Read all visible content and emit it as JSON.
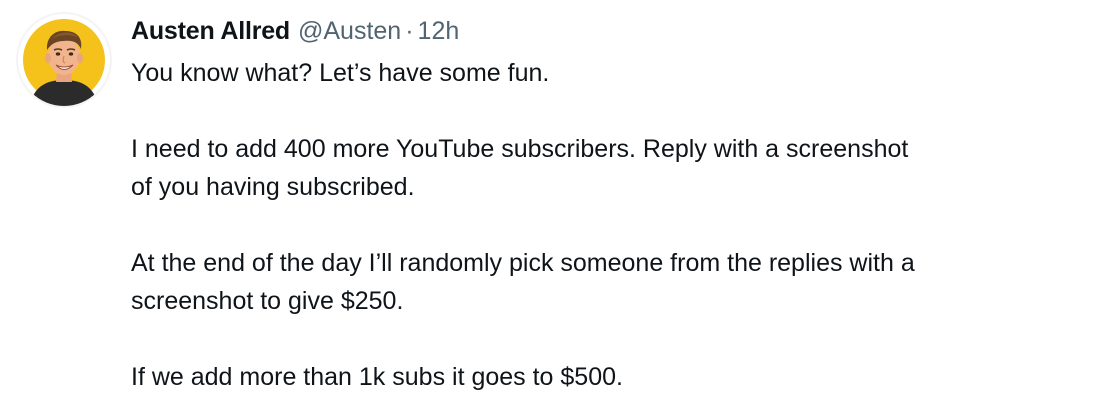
{
  "tweet": {
    "author_name": "Austen Allred",
    "author_handle": "@Austen",
    "separator": "·",
    "timestamp": "12h",
    "avatar_icon": "user-avatar-icon",
    "paragraphs": [
      {
        "lines": [
          "You know what? Let’s have some fun."
        ]
      },
      {
        "lines": [
          "I need to add 400 more YouTube subscribers. Reply with a screenshot",
          "of you having subscribed."
        ]
      },
      {
        "lines": [
          "At the end of the day I’ll randomly pick someone from the replies with a",
          "screenshot to give $250."
        ]
      },
      {
        "lines": [
          "If we add more than 1k subs it goes to $500."
        ]
      }
    ],
    "colors": {
      "text_primary": "#0f1419",
      "text_secondary": "#536471",
      "avatar_background": "#f5c21b"
    }
  }
}
